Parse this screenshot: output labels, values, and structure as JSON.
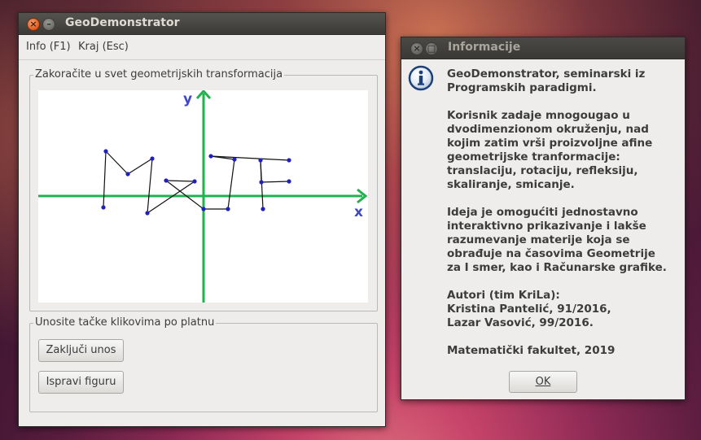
{
  "main_window": {
    "title": "GeoDemonstrator",
    "menu": [
      "Info (F1)",
      "Kraj (Esc)"
    ],
    "canvas_group_title": "Zakoračite u svet geometrijskih transformacija",
    "axis_x_label": "x",
    "axis_y_label": "y",
    "input_group_title": "Unosite tačke klikovima po platnu",
    "buttons": {
      "finish": "Zaključi unos",
      "fix": "Ispravi figuru"
    }
  },
  "info_dialog": {
    "title": "Informacije",
    "icon": "info-icon",
    "paragraphs": [
      "GeoDemonstrator, seminarski iz\nProgramskih paradigmi.",
      "Korisnik zadaje mnogougao u\ndvodimenzionom okruženju, nad\nkojim zatim vrši proizvoljne afine\ngeometrijske tranformacije:\ntranslaciju, rotaciju, refleksiju,\nskaliranje, smicanje.",
      "Ideja je omogućiti jednostavno\ninteraktivno prikazivanje i lakše\nrazumevanje materije koja se\nobrađuje na časovima Geometrije\nza I smer, kao i Računarske grafike.",
      "Autori (tim KriLa):\nKristina Pantelić, 91/2016,\nLazar Vasović, 99/2016.",
      "Matematički fakultet, 2019"
    ],
    "ok_label": "OK"
  },
  "colors": {
    "axis": "#22b14c",
    "axis_label": "#3f48cc",
    "figure_line": "#111111",
    "figure_point": "#2020c0"
  }
}
